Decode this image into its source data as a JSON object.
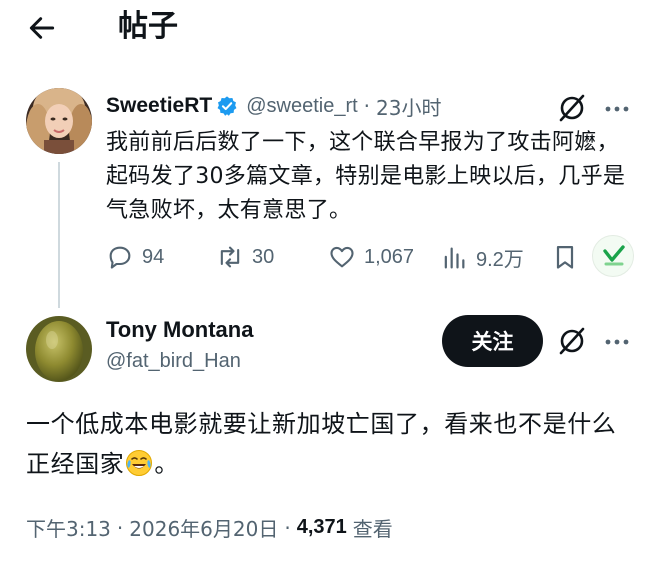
{
  "header": {
    "title": "帖子",
    "back_icon": "arrow-left-icon"
  },
  "parent_tweet": {
    "name": "SweetieRT",
    "handle": "@sweetie_rt",
    "separator": "·",
    "time": "23小时",
    "verified": true,
    "verified_color": "#1d9bf0",
    "text": "我前前后后数了一下，这个联合早报为了攻击阿嬷，起码发了30多篇文章，特别是电影上映以后，几乎是气急败坏，太有意思了。",
    "stats": {
      "replies": "94",
      "retweets": "30",
      "likes": "1,067",
      "views": "9.2万"
    }
  },
  "main_tweet": {
    "name": "Tony Montana",
    "handle": "@fat_bird_Han",
    "follow_label": "关注",
    "text_part1": "一个低成本电影就要让新加坡亡国了，看来也不是什么正经国家",
    "emoji": "face-with-tears-of-joy",
    "text_part2": "。",
    "meta": {
      "time": "下午3:13",
      "separator": "·",
      "date": "2026年6月20日",
      "views": "4,371",
      "views_label": "查看"
    }
  },
  "colors": {
    "text": "#0f1419",
    "secondary": "#536471",
    "accent": "#1d9bf0",
    "button": "#0f1419",
    "grok_green": "#1aa34a"
  }
}
